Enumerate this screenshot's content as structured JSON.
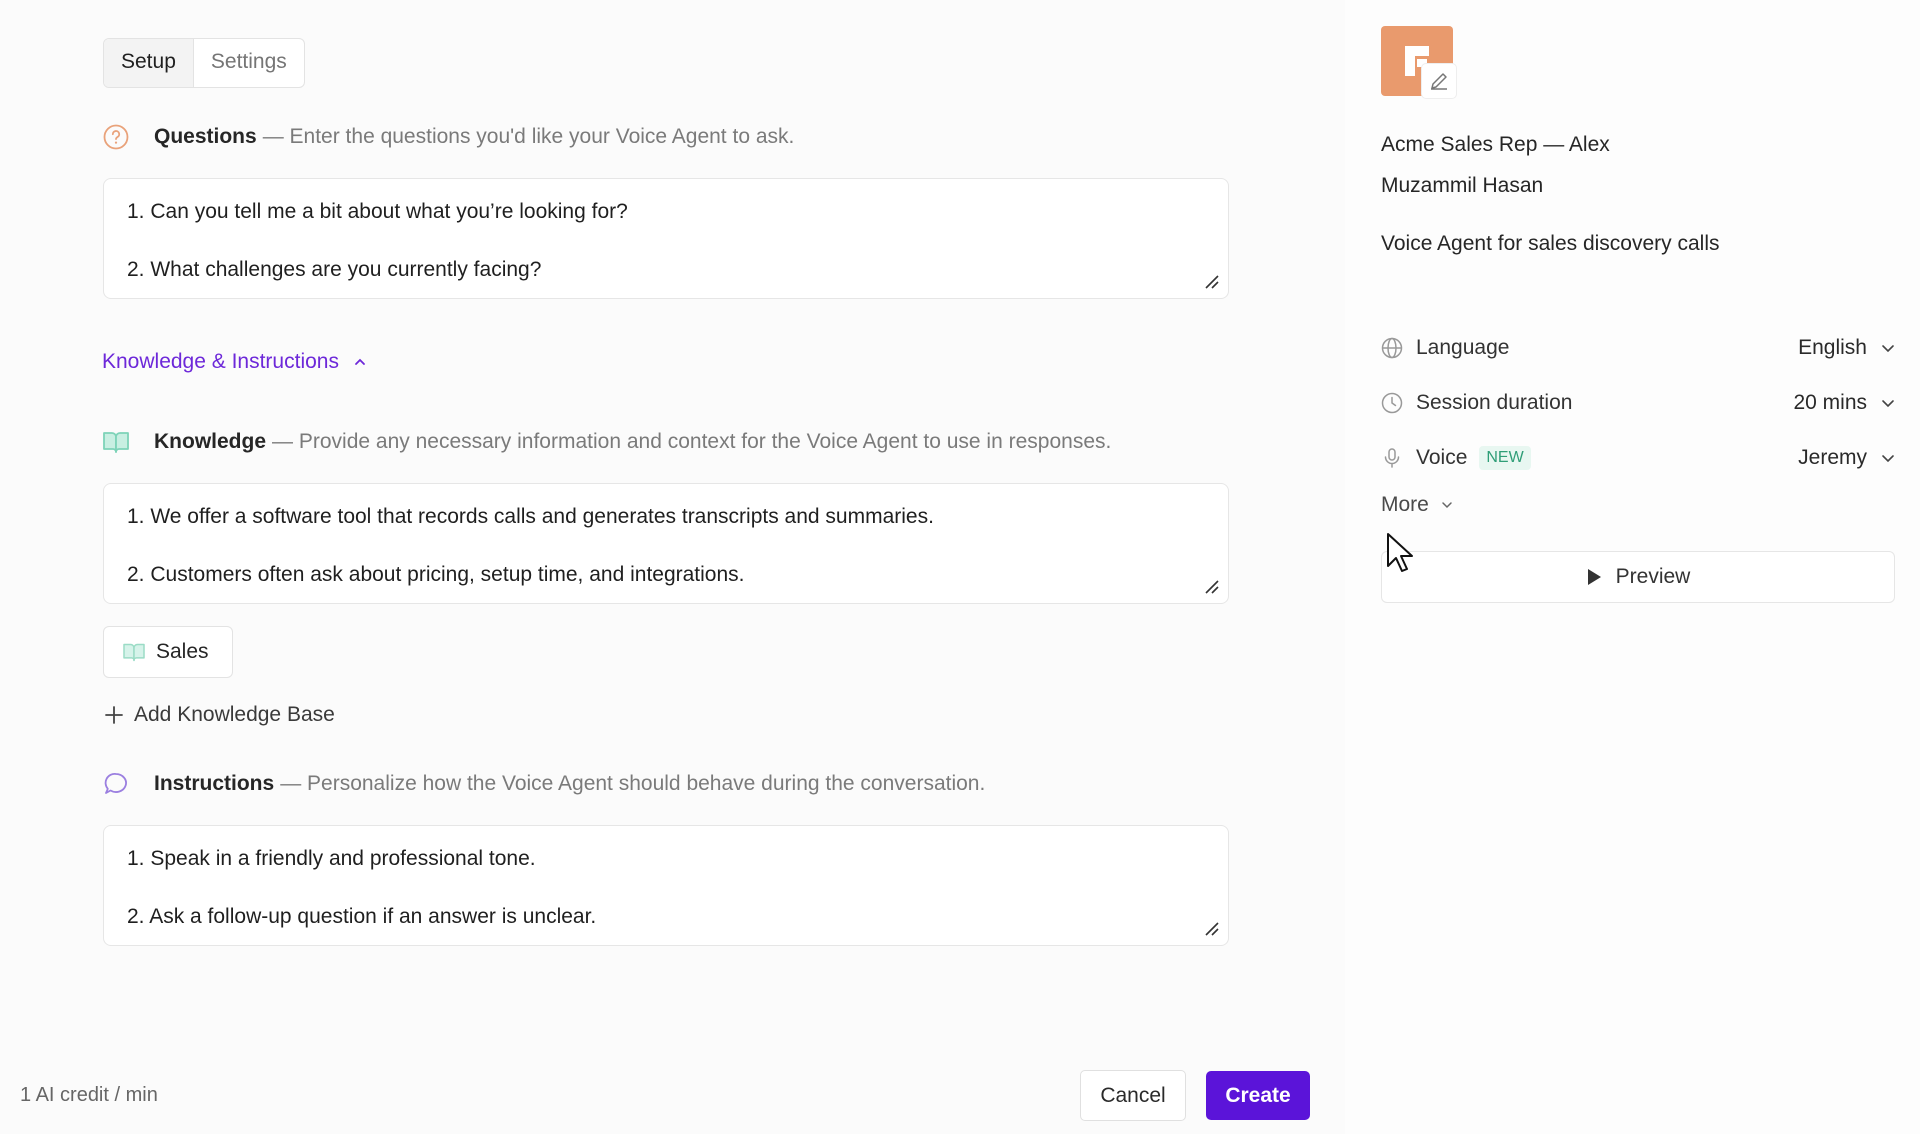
{
  "tabs": [
    {
      "label": "Setup",
      "active": true
    },
    {
      "label": "Settings",
      "active": false
    }
  ],
  "questions": {
    "title": "Questions",
    "description": "— Enter the questions you'd like your Voice Agent to ask.",
    "lines": [
      "1. Can you tell me a bit about what you’re looking for?",
      "2. What challenges are you currently facing?"
    ]
  },
  "knowledge_toggle": {
    "label": "Knowledge & Instructions",
    "expanded": true
  },
  "knowledge": {
    "title": "Knowledge",
    "description": "— Provide any necessary information and context for the Voice Agent to use in responses.",
    "lines": [
      "1. We offer a software tool that records calls and generates transcripts and summaries.",
      "2. Customers often ask about pricing, setup time, and integrations."
    ],
    "chip_label": "Sales",
    "add_label": "Add Knowledge Base"
  },
  "instructions": {
    "title": "Instructions",
    "description": "— Personalize how the Voice Agent should behave during the conversation.",
    "lines": [
      "1. Speak in a friendly and professional tone.",
      "2. Ask a follow-up question if an answer is unclear."
    ]
  },
  "footer": {
    "credit": "1 AI credit / min",
    "cancel_label": "Cancel",
    "create_label": "Create"
  },
  "agent": {
    "name": "Acme Sales Rep — Alex",
    "owner": "Muzammil Hasan",
    "description": "Voice Agent for sales discovery calls"
  },
  "settings": {
    "language": {
      "label": "Language",
      "value": "English"
    },
    "session": {
      "label": "Session duration",
      "value": "20 mins"
    },
    "voice": {
      "label": "Voice",
      "badge": "NEW",
      "value": "Jeremy"
    },
    "more_label": "More",
    "preview_label": "Preview"
  },
  "colors": {
    "accent": "#5b14d9",
    "link": "#6d28d9",
    "avatar": "#e99a6d",
    "questions_icon": "#e9a27a",
    "knowledge_icon": "#7dd3b8",
    "instructions_icon": "#9b7fe0"
  },
  "icons": [
    "question-circle-icon",
    "book-open-icon",
    "chat-bubble-icon",
    "globe-icon",
    "clock-icon",
    "microphone-icon",
    "chevron-down-icon",
    "chevron-up-icon",
    "plus-icon",
    "play-icon",
    "pencil-icon",
    "resize-grip-icon",
    "mouse-pointer-icon"
  ]
}
